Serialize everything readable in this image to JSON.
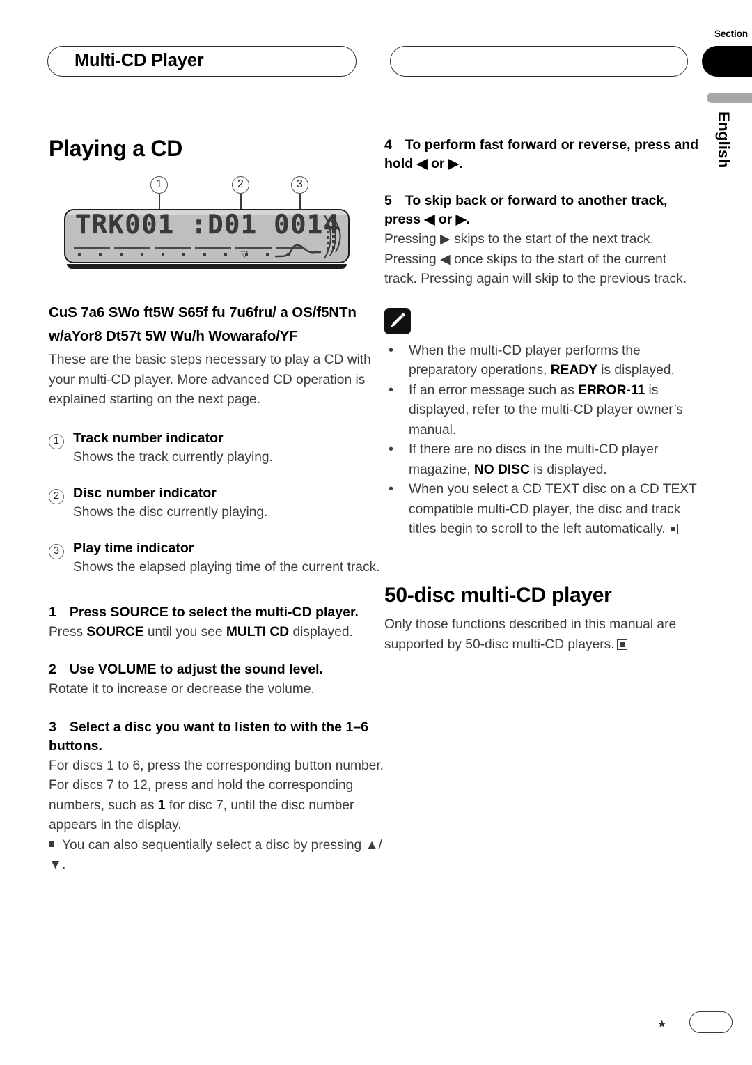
{
  "header": {
    "left_title": "Multi-CD Player",
    "right_title": "",
    "section_label": "Section",
    "language_tab": "English"
  },
  "left_column": {
    "title": "Playing a CD",
    "figure": {
      "callouts": [
        "1",
        "2",
        "3"
      ],
      "lcd_text": "TRK001  :D01 0014",
      "lcd_track": "TRK001",
      "lcd_disc": ":D01",
      "lcd_time": "0014"
    },
    "garbled_heading_line1": "CuS 7a6 SWo ft5W S65f fu 7u6fru/ a OS/f5NTn",
    "garbled_heading_line2": "w/aYor8 Dt57t 5W Wu/h Wowarafo/YF",
    "intro": "These are the basic steps necessary to play a CD with your multi-CD player. More advanced CD operation is explained starting on the next page.",
    "indicators": [
      {
        "num": "1",
        "title": "Track number indicator",
        "desc": "Shows the track currently playing."
      },
      {
        "num": "2",
        "title": "Disc number indicator",
        "desc": "Shows the disc currently playing."
      },
      {
        "num": "3",
        "title": "Play time indicator",
        "desc": "Shows the elapsed playing time of the current track."
      }
    ],
    "steps": [
      {
        "num": "1",
        "head": "Press SOURCE to select the multi-CD player.",
        "body_pre": "Press ",
        "body_b1": "SOURCE",
        "body_mid": " until you see ",
        "body_b2": "MULTI CD",
        "body_post": " displayed."
      },
      {
        "num": "2",
        "head": "Use VOLUME to adjust the sound level.",
        "body": "Rotate it to increase or decrease the volume."
      },
      {
        "num": "3",
        "head": "Select a disc you want to listen to with the 1–6 buttons.",
        "body_line1": "For discs 1 to 6, press the corresponding button number.",
        "body_line2_pre": "For discs 7 to 12, press and hold the corresponding numbers, such as ",
        "body_line2_b": "1",
        "body_line2_post": " for disc 7, until the disc number appears in the display.",
        "sub_bullet": "You can also sequentially select a disc by pressing ▲/▼."
      }
    ]
  },
  "right_column": {
    "steps": [
      {
        "num": "4",
        "head": "To perform fast forward or reverse, press and hold ◀ or ▶."
      },
      {
        "num": "5",
        "head": "To skip back or forward to another track, press ◀ or ▶.",
        "body": "Pressing ▶ skips to the start of the next track. Pressing ◀ once skips to the start of the current track. Pressing again will skip to the previous track."
      }
    ],
    "note_icon": "pencil-note-icon",
    "notes": [
      {
        "pre": "When the multi-CD player performs the preparatory operations, ",
        "bold": "READY",
        "post": " is displayed."
      },
      {
        "pre": "If an error message such as ",
        "bold": "ERROR-11",
        "post": " is displayed, refer to the multi-CD player owner’s manual."
      },
      {
        "pre": "If there are no discs in the multi-CD player magazine, ",
        "bold": "NO DISC",
        "post": " is displayed."
      },
      {
        "pre": "When you select a CD TEXT disc on a CD TEXT compatible multi-CD player, the disc and track titles begin to scroll to the left automatically.",
        "bold": "",
        "post": "",
        "end_marker": true
      }
    ],
    "subsection": {
      "title": "50-disc multi-CD player",
      "body": "Only those functions described in this manual are supported by 50-disc multi-CD players."
    }
  },
  "footer": {
    "star": "★",
    "page_number": ""
  },
  "colors": {
    "text": "#3c3c3c",
    "heading": "#000000",
    "lcd_background": "#bfbfbf",
    "tab_black": "#000000",
    "bar_gray": "#a8a8a8"
  }
}
